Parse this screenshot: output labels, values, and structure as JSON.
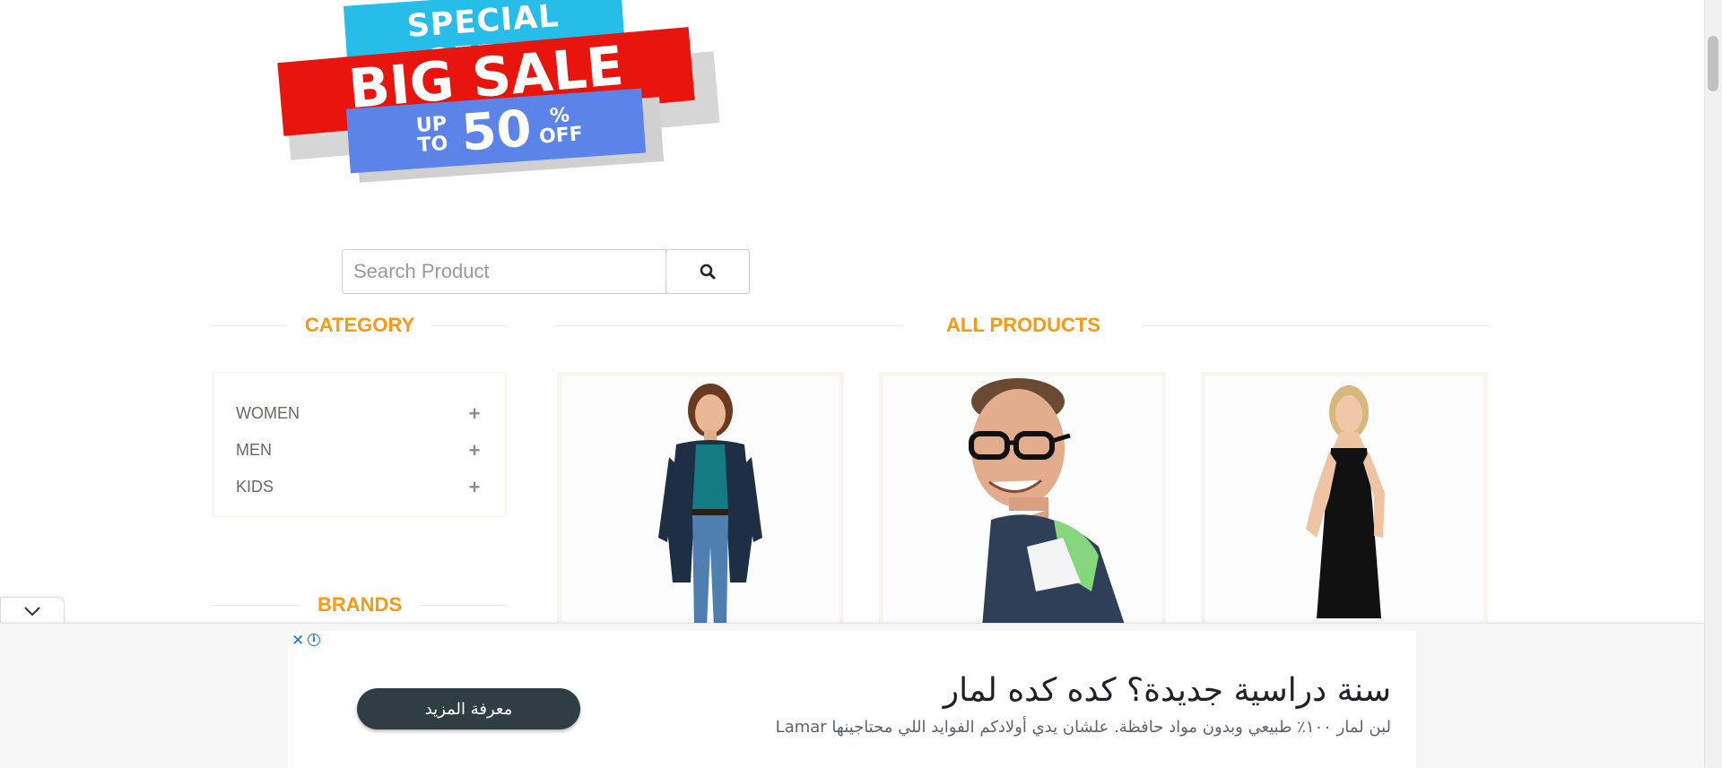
{
  "banner": {
    "special_offer": "SPECIAL OFFER",
    "big_sale": "BIG SALE",
    "up_to": "UP TO",
    "percent": "50",
    "percent_sign": "%",
    "off": "OFF",
    "colors": {
      "cyan": "#27bde9",
      "red": "#e8150f",
      "blue": "#5b83e8"
    }
  },
  "search": {
    "placeholder": "Search Product",
    "button_icon": "search-icon"
  },
  "sidebar": {
    "category_title": "CATEGORY",
    "categories": [
      {
        "label": "WOMEN",
        "icon": "plus-icon"
      },
      {
        "label": "MEN",
        "icon": "plus-icon"
      },
      {
        "label": "KIDS",
        "icon": "plus-icon"
      }
    ],
    "brands_title": "BRANDS"
  },
  "main": {
    "title": "ALL PRODUCTS",
    "products": [
      {
        "image": "woman-casual-denim-photo"
      },
      {
        "image": "man-glasses-polo-photo"
      },
      {
        "image": "woman-black-dress-photo"
      }
    ]
  },
  "ad": {
    "collapse_icon": "chevron-down-icon",
    "close_icon": "close-icon",
    "info_icon": "info-icon",
    "cta_label": "معرفة المزيد",
    "title": "سنة دراسية جديدة؟ كده كده لمار",
    "description": "لبن لمار ١٠٠٪ طبيعي وبدون مواد حافظة. علشان يدي أولادكم الفوايد اللي محتاجينها Lamar"
  },
  "theme": {
    "accent": "#fe980f",
    "ad_button": "#2f3e45"
  }
}
